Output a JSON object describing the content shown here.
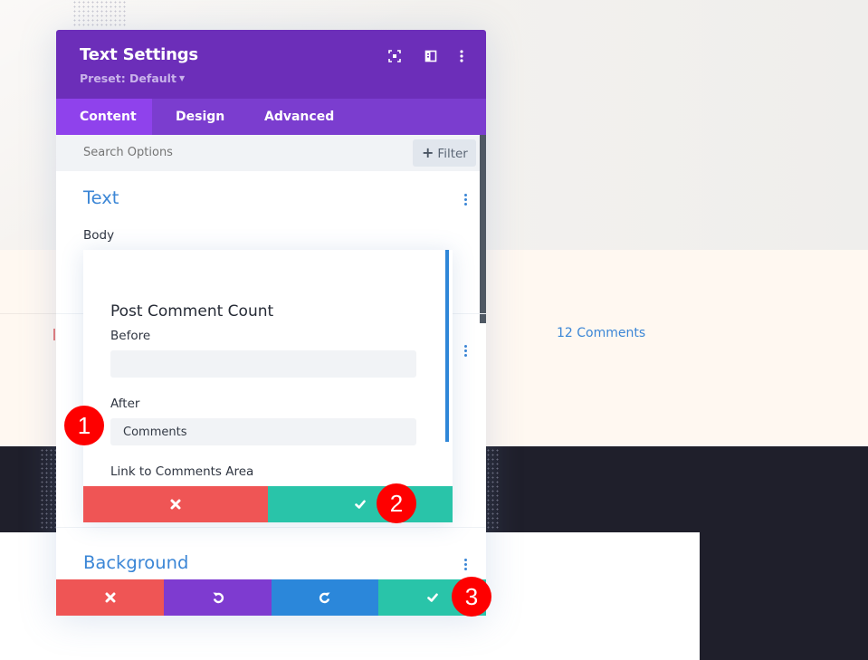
{
  "page": {
    "comment_link_text": "12 Comments"
  },
  "panel": {
    "title": "Text Settings",
    "preset_label": "Preset: Default",
    "header_icons": [
      "expand-icon",
      "sidebar-layout-icon",
      "more-options-icon"
    ],
    "tabs": [
      {
        "label": "Content",
        "active": true
      },
      {
        "label": "Design",
        "active": false
      },
      {
        "label": "Advanced",
        "active": false
      }
    ],
    "search": {
      "placeholder": "Search Options",
      "filter_label": "Filter"
    },
    "sections": [
      {
        "title": "Text",
        "field_label": "Body"
      },
      {
        "title": "Background"
      }
    ],
    "actions": [
      "discard",
      "undo",
      "redo",
      "save"
    ]
  },
  "sub_modal": {
    "title": "Post Comment Count",
    "fields": [
      {
        "label": "Before",
        "value": ""
      },
      {
        "label": "After",
        "value": "Comments"
      },
      {
        "label": "Link to Comments Area"
      }
    ],
    "actions": [
      "cancel",
      "confirm"
    ]
  },
  "annotations": [
    "1",
    "2",
    "3"
  ],
  "colors": {
    "header_purple": "#6c2eb9",
    "tab_bar": "#7b3dcf",
    "active_tab": "#8f42ec",
    "accent_blue": "#3b86d6",
    "cancel_red": "#ef5555",
    "undo_purple": "#7e3bd0",
    "redo_blue": "#2b87da",
    "save_teal": "#29c4a9",
    "annotation_red": "#fe0000"
  }
}
